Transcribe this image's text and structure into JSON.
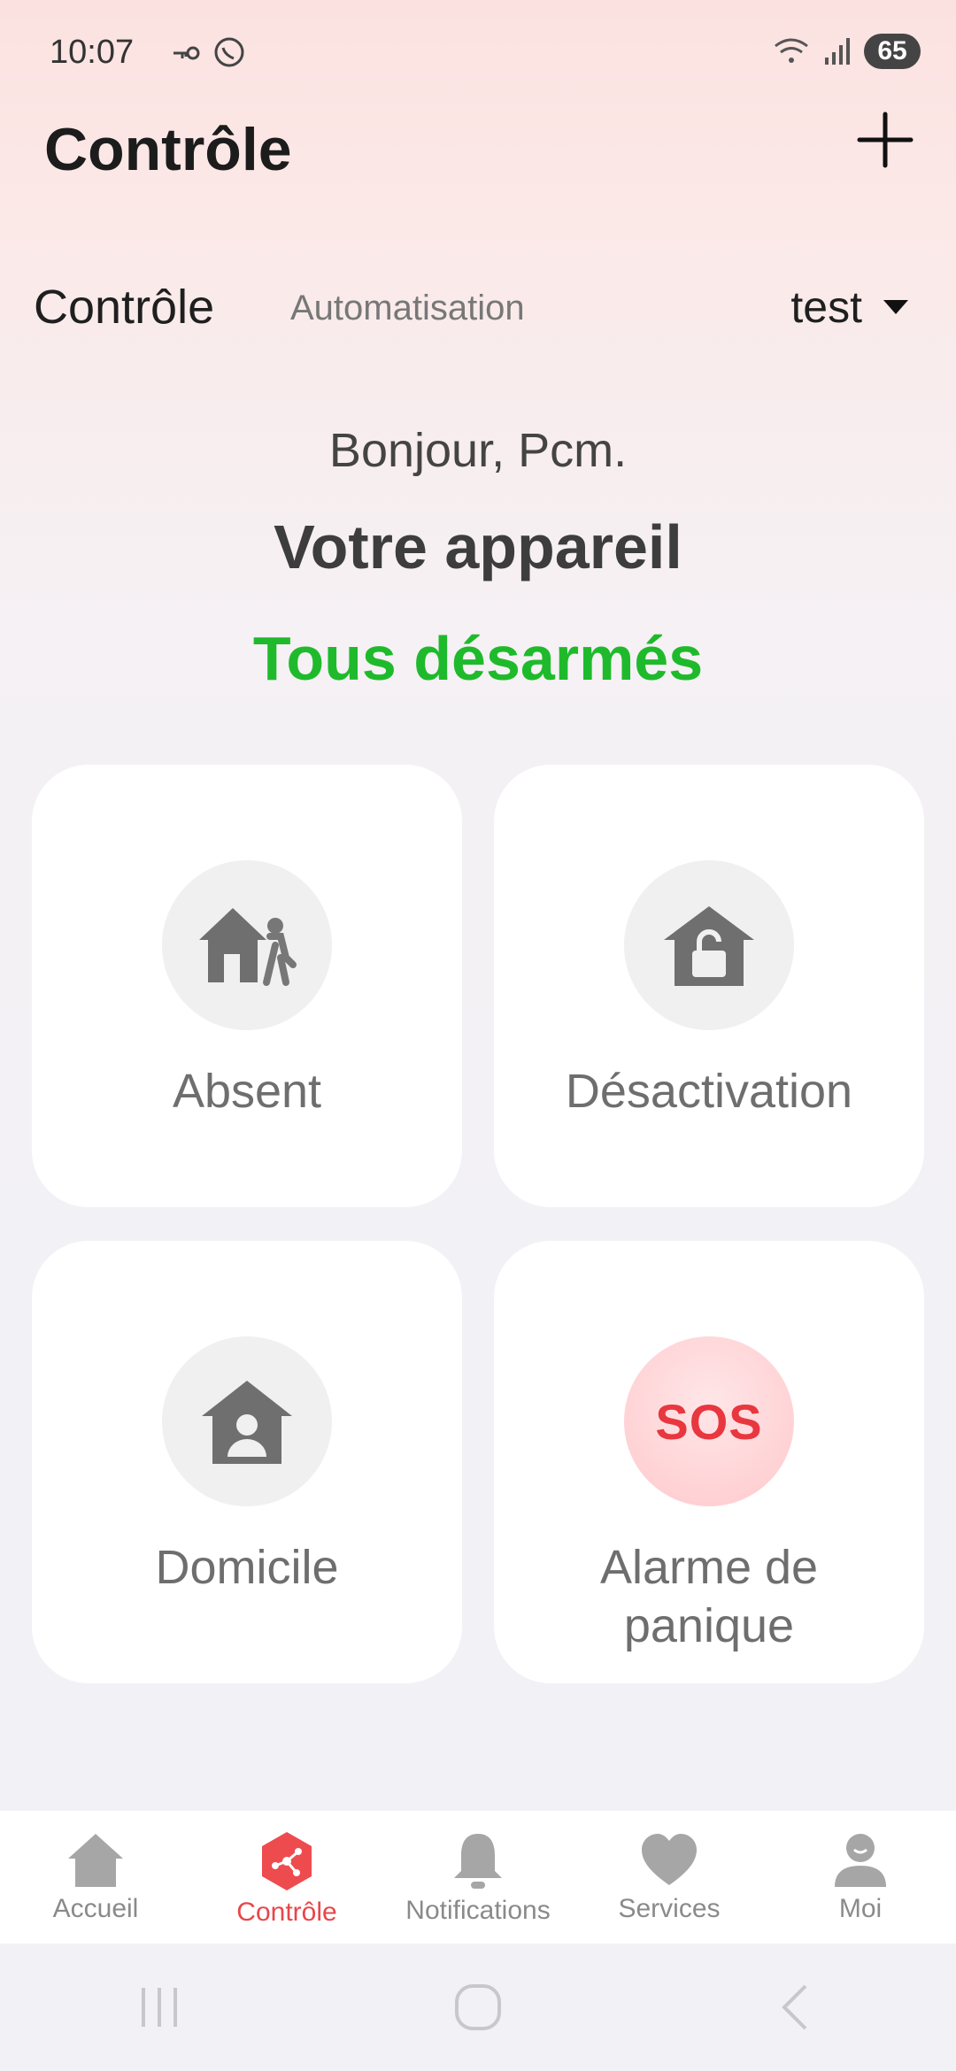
{
  "status_bar": {
    "time": "10:07",
    "battery": "65"
  },
  "header": {
    "title": "Contrôle"
  },
  "tabs": [
    {
      "label": "Contrôle",
      "active": true
    },
    {
      "label": "Automatisation",
      "active": false
    }
  ],
  "home_selector": {
    "label": "test"
  },
  "greeting": "Bonjour, Pcm.",
  "device_title": "Votre appareil",
  "device_status": "Tous désarmés",
  "colors": {
    "status_green": "#1fba2b",
    "accent_red": "#e8464a"
  },
  "cards": [
    {
      "label": "Absent",
      "icon": "house-walking-icon"
    },
    {
      "label": "Désactivation",
      "icon": "house-unlock-icon"
    },
    {
      "label": "Domicile",
      "icon": "house-person-icon"
    },
    {
      "label": "Alarme de panique",
      "icon": "sos-icon",
      "badge": "SOS"
    }
  ],
  "bottom_nav": [
    {
      "label": "Accueil",
      "icon": "home-icon"
    },
    {
      "label": "Contrôle",
      "icon": "control-icon",
      "active": true
    },
    {
      "label": "Notifications",
      "icon": "bell-icon"
    },
    {
      "label": "Services",
      "icon": "heart-icon"
    },
    {
      "label": "Moi",
      "icon": "user-icon"
    }
  ]
}
